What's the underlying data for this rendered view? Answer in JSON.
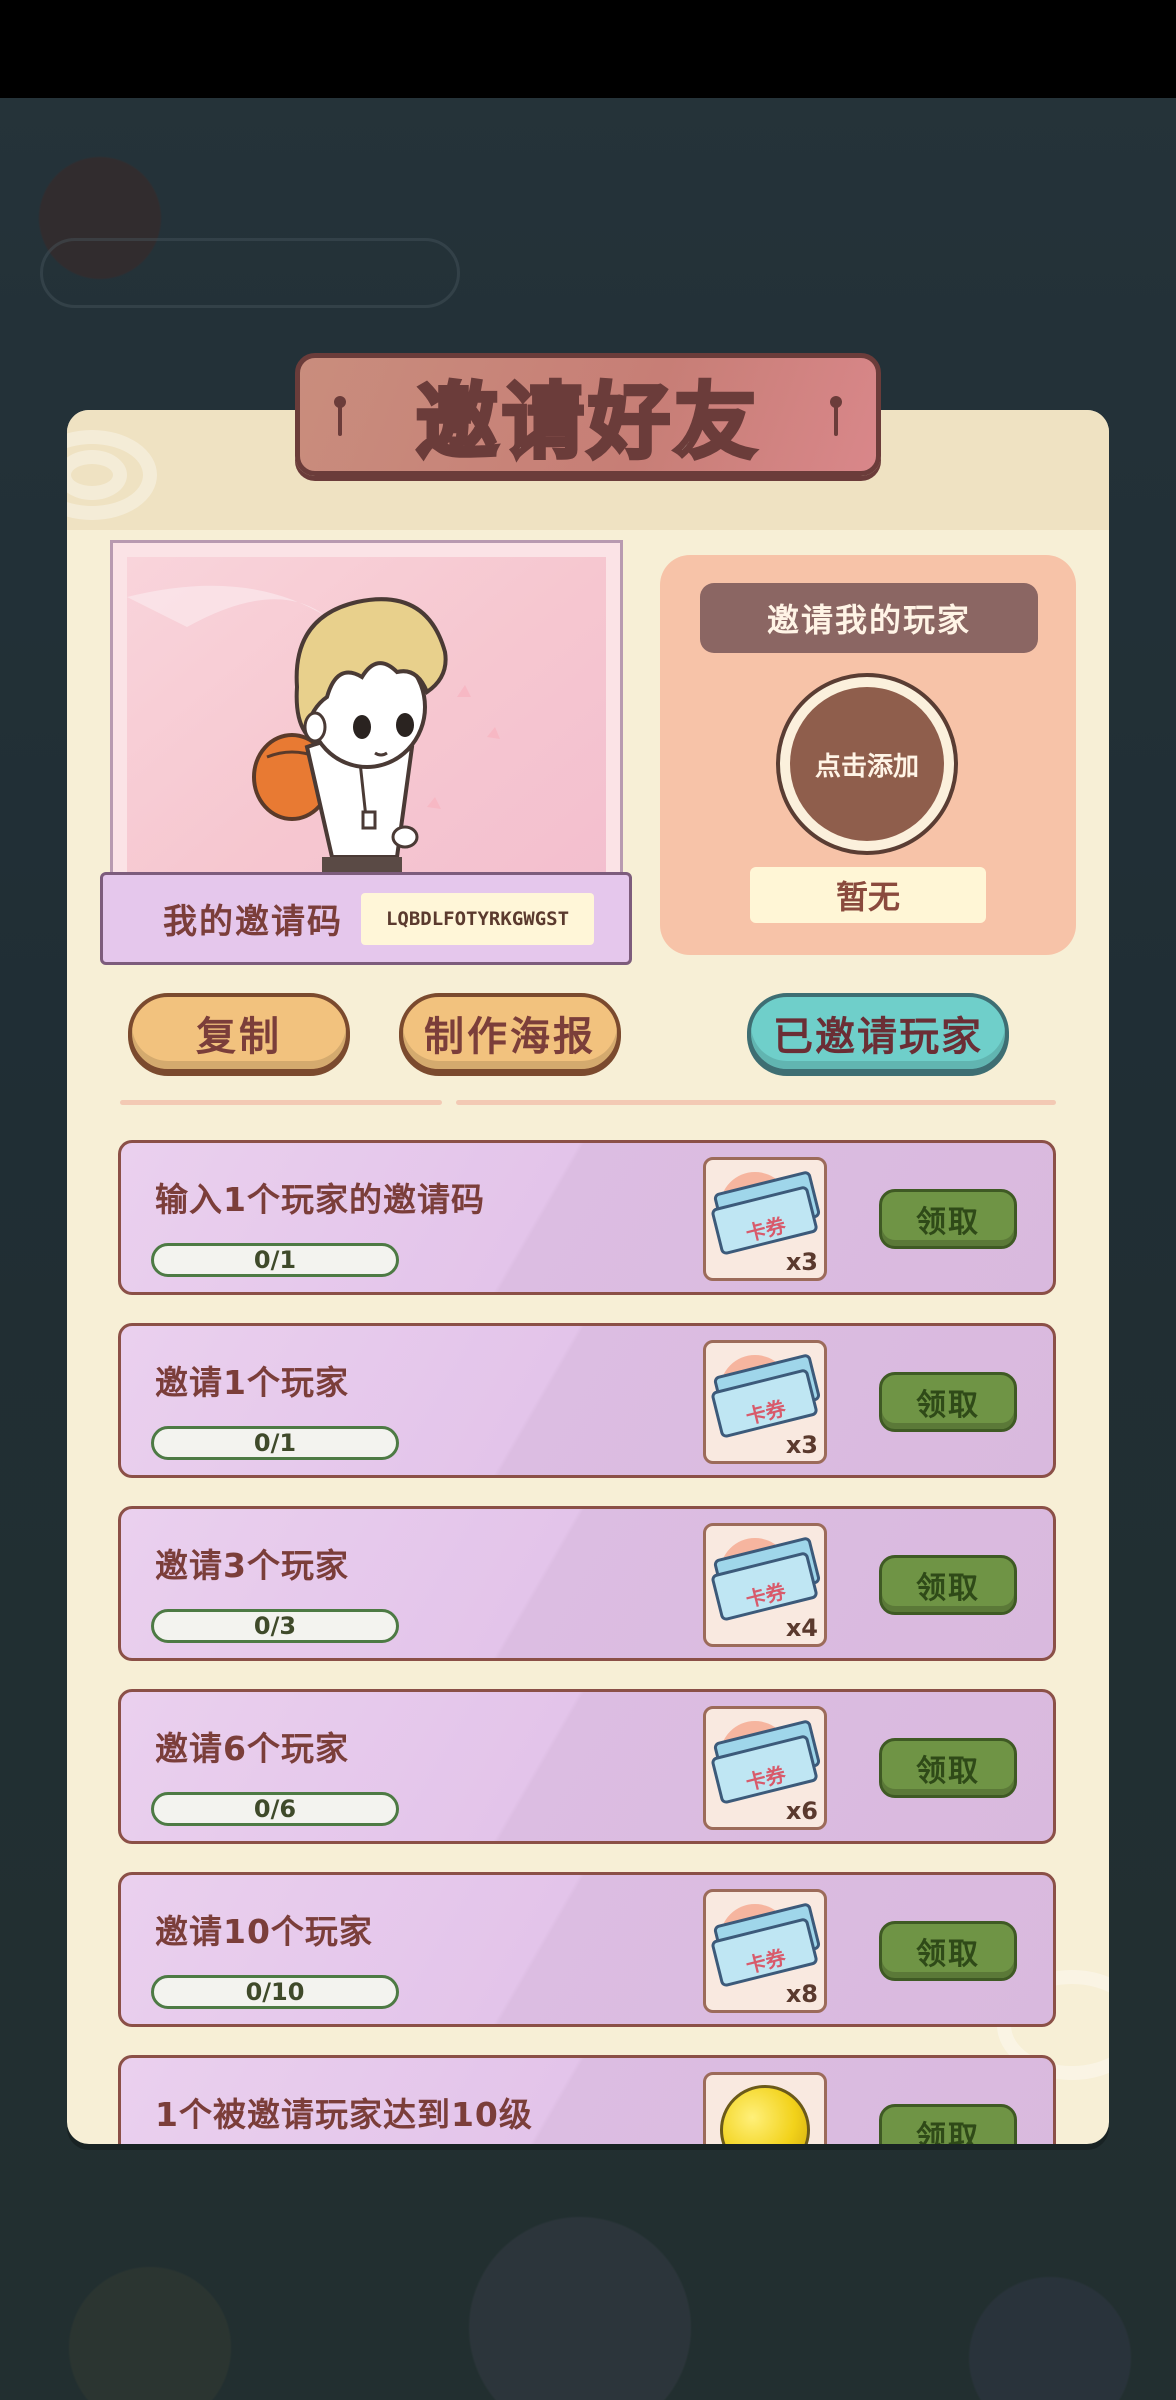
{
  "title": "邀请好友",
  "my_code": {
    "label": "我的邀请码",
    "value": "LQBDLFOTYRKGWGST"
  },
  "inviter": {
    "title": "邀请我的玩家",
    "add_label": "点击添加",
    "none_label": "暂无"
  },
  "buttons": {
    "copy": "复制",
    "poster": "制作海报",
    "invited": "已邀请玩家"
  },
  "tasks": [
    {
      "title": "输入1个玩家的邀请码",
      "progress": "0/1",
      "reward_label": "卡券",
      "reward_count": "x3",
      "claim": "领取"
    },
    {
      "title": "邀请1个玩家",
      "progress": "0/1",
      "reward_label": "卡券",
      "reward_count": "x3",
      "claim": "领取"
    },
    {
      "title": "邀请3个玩家",
      "progress": "0/3",
      "reward_label": "卡券",
      "reward_count": "x4",
      "claim": "领取"
    },
    {
      "title": "邀请6个玩家",
      "progress": "0/6",
      "reward_label": "卡券",
      "reward_count": "x6",
      "claim": "领取"
    },
    {
      "title": "邀请10个玩家",
      "progress": "0/10",
      "reward_label": "卡券",
      "reward_count": "x8",
      "claim": "领取"
    },
    {
      "title": "1个被邀请玩家达到10级",
      "progress": "",
      "reward_icon": "gold-coin-icon",
      "claim": "领取"
    }
  ],
  "colors": {
    "panel": "#f7efd6",
    "banner": "#c77e76",
    "task_bg": "#e3c4ea",
    "claim_button": "#6f9445",
    "copy_button": "#f2c27e",
    "invited_button": "#6fcfca"
  }
}
